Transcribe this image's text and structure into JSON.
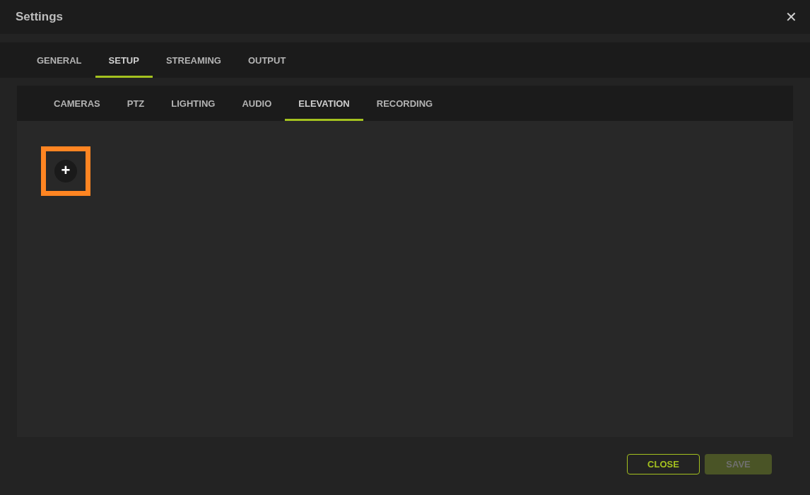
{
  "window": {
    "title": "Settings",
    "close_symbol": "✕"
  },
  "tabs": [
    {
      "label": "GENERAL",
      "selected": false
    },
    {
      "label": "SETUP",
      "selected": true
    },
    {
      "label": "STREAMING",
      "selected": false
    },
    {
      "label": "OUTPUT",
      "selected": false
    }
  ],
  "subtabs": [
    {
      "label": "CAMERAS",
      "selected": false
    },
    {
      "label": "PTZ",
      "selected": false
    },
    {
      "label": "LIGHTING",
      "selected": false
    },
    {
      "label": "AUDIO",
      "selected": false
    },
    {
      "label": "ELEVATION",
      "selected": true
    },
    {
      "label": "RECORDING",
      "selected": false
    }
  ],
  "add_button": {
    "symbol": "+",
    "highlighted": true
  },
  "buttons": [
    {
      "label": "CLOSE",
      "kind": "outline",
      "disabled": false
    },
    {
      "label": "SAVE",
      "kind": "filled",
      "disabled": true
    }
  ]
}
